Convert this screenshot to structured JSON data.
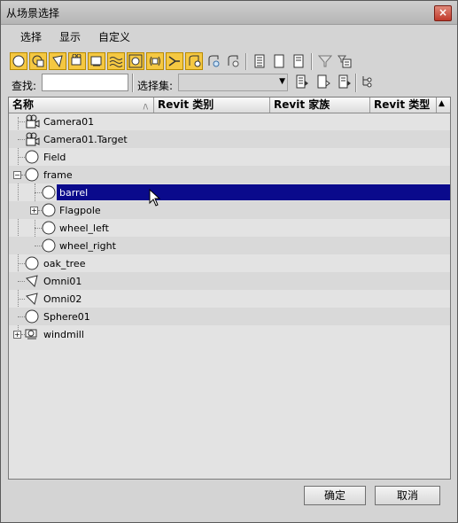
{
  "window": {
    "title": "从场景选择"
  },
  "menu": [
    "选择",
    "显示",
    "自定义"
  ],
  "find": {
    "label": "查找:",
    "value": ""
  },
  "selection_set": {
    "label": "选择集:",
    "value": ""
  },
  "columns": [
    "名称",
    "Revit 类别",
    "Revit 家族",
    "Revit 类型"
  ],
  "tree": [
    {
      "label": "Camera01",
      "icon": "camera-icon"
    },
    {
      "label": "Camera01.Target",
      "icon": "camera-target-icon"
    },
    {
      "label": "Field",
      "icon": "geometry-sphere-icon"
    },
    {
      "label": "frame",
      "icon": "geometry-sphere-icon",
      "expanded": true
    },
    {
      "label": "barrel",
      "icon": "geometry-sphere-icon",
      "selected": true
    },
    {
      "label": "Flagpole",
      "icon": "geometry-sphere-icon",
      "collapsed": true
    },
    {
      "label": "wheel_left",
      "icon": "geometry-sphere-icon"
    },
    {
      "label": "wheel_right",
      "icon": "geometry-sphere-icon"
    },
    {
      "label": "oak_tree",
      "icon": "geometry-sphere-icon"
    },
    {
      "label": "Omni01",
      "icon": "light-icon"
    },
    {
      "label": "Omni02",
      "icon": "light-icon"
    },
    {
      "label": "Sphere01",
      "icon": "geometry-sphere-icon"
    },
    {
      "label": "windmill",
      "icon": "group-icon",
      "collapsed": true
    }
  ],
  "buttons": {
    "ok": "确定",
    "cancel": "取消"
  },
  "colors": {
    "selection": "#0a0a8c",
    "toggle_on": "#f5c842"
  }
}
